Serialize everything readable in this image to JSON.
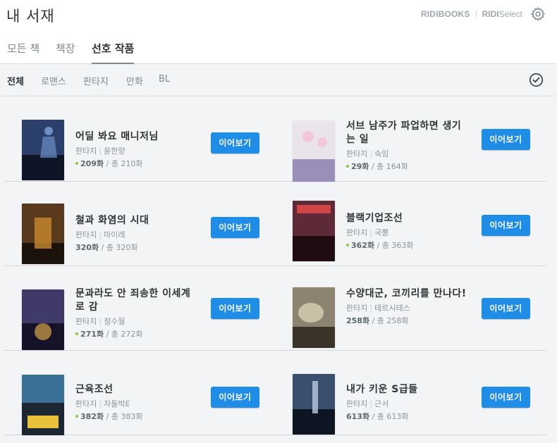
{
  "header": {
    "title": "내 서재",
    "brand_ridibooks": "RIDIBOOKS",
    "brand_select_bold": "RIDI",
    "brand_select": "Select",
    "settings_icon": "gear-icon"
  },
  "tabs": [
    {
      "label": "모든 책",
      "active": false
    },
    {
      "label": "책장",
      "active": false
    },
    {
      "label": "선호 작품",
      "active": true
    }
  ],
  "filters": [
    {
      "label": "전체",
      "active": true
    },
    {
      "label": "로맨스",
      "active": false
    },
    {
      "label": "판타지",
      "active": false
    },
    {
      "label": "만화",
      "active": false
    },
    {
      "label": "BL",
      "active": false
    }
  ],
  "select_icon": "check-circle-icon",
  "read_label": "이어보기",
  "books": [
    {
      "title": "어딜 봐요 매니저님",
      "genre": "판타지",
      "author": "윤한량",
      "read": "209화",
      "total": "/ 총 210화",
      "dot": true,
      "cover": [
        "#2a3f6a",
        "#0d1526",
        "#6d8ec7"
      ]
    },
    {
      "title": "서브 남주가 파업하면 생기는 일",
      "genre": "판타지",
      "author": "숙임",
      "read": "29화",
      "total": "/ 총 164화",
      "dot": true,
      "cover": [
        "#e9e3ea",
        "#9a8fb8",
        "#f2c8d6"
      ]
    },
    {
      "title": "철과 화염의 시대",
      "genre": "판타지",
      "author": "마이레",
      "read": "320화",
      "total": "/ 총 320화",
      "dot": false,
      "cover": [
        "#5a3a1c",
        "#1b120b",
        "#c98a2f"
      ]
    },
    {
      "title": "블랙기업조선",
      "genre": "판타지",
      "author": "국뽕",
      "read": "362화",
      "total": "/ 총 363화",
      "dot": true,
      "cover": [
        "#5e2a38",
        "#1e0c12",
        "#d04545"
      ]
    },
    {
      "title": "문과라도 안 죄송한 이세계로 감",
      "genre": "판타지",
      "author": "정수월",
      "read": "271화",
      "total": "/ 총 272화",
      "dot": true,
      "cover": [
        "#3f3a6a",
        "#161328",
        "#d7a24a"
      ]
    },
    {
      "title": "수양대군, 코끼리를 만나다!",
      "genre": "판타지",
      "author": "테르시테스",
      "read": "258화",
      "total": "/ 총 258화",
      "dot": false,
      "cover": [
        "#8c8370",
        "#3a3428",
        "#c9c0a8"
      ]
    },
    {
      "title": "근육조선",
      "genre": "판타지",
      "author": "차돌박E",
      "read": "382화",
      "total": "/ 총 383화",
      "dot": true,
      "cover": [
        "#3a6f96",
        "#1d2733",
        "#e8c03a"
      ]
    },
    {
      "title": "내가 키운 S급들",
      "genre": "판타지",
      "author": "근서",
      "read": "613화",
      "total": "/ 총 613화",
      "dot": false,
      "cover": [
        "#3a4e6e",
        "#0e1522",
        "#b8c8de"
      ]
    }
  ]
}
